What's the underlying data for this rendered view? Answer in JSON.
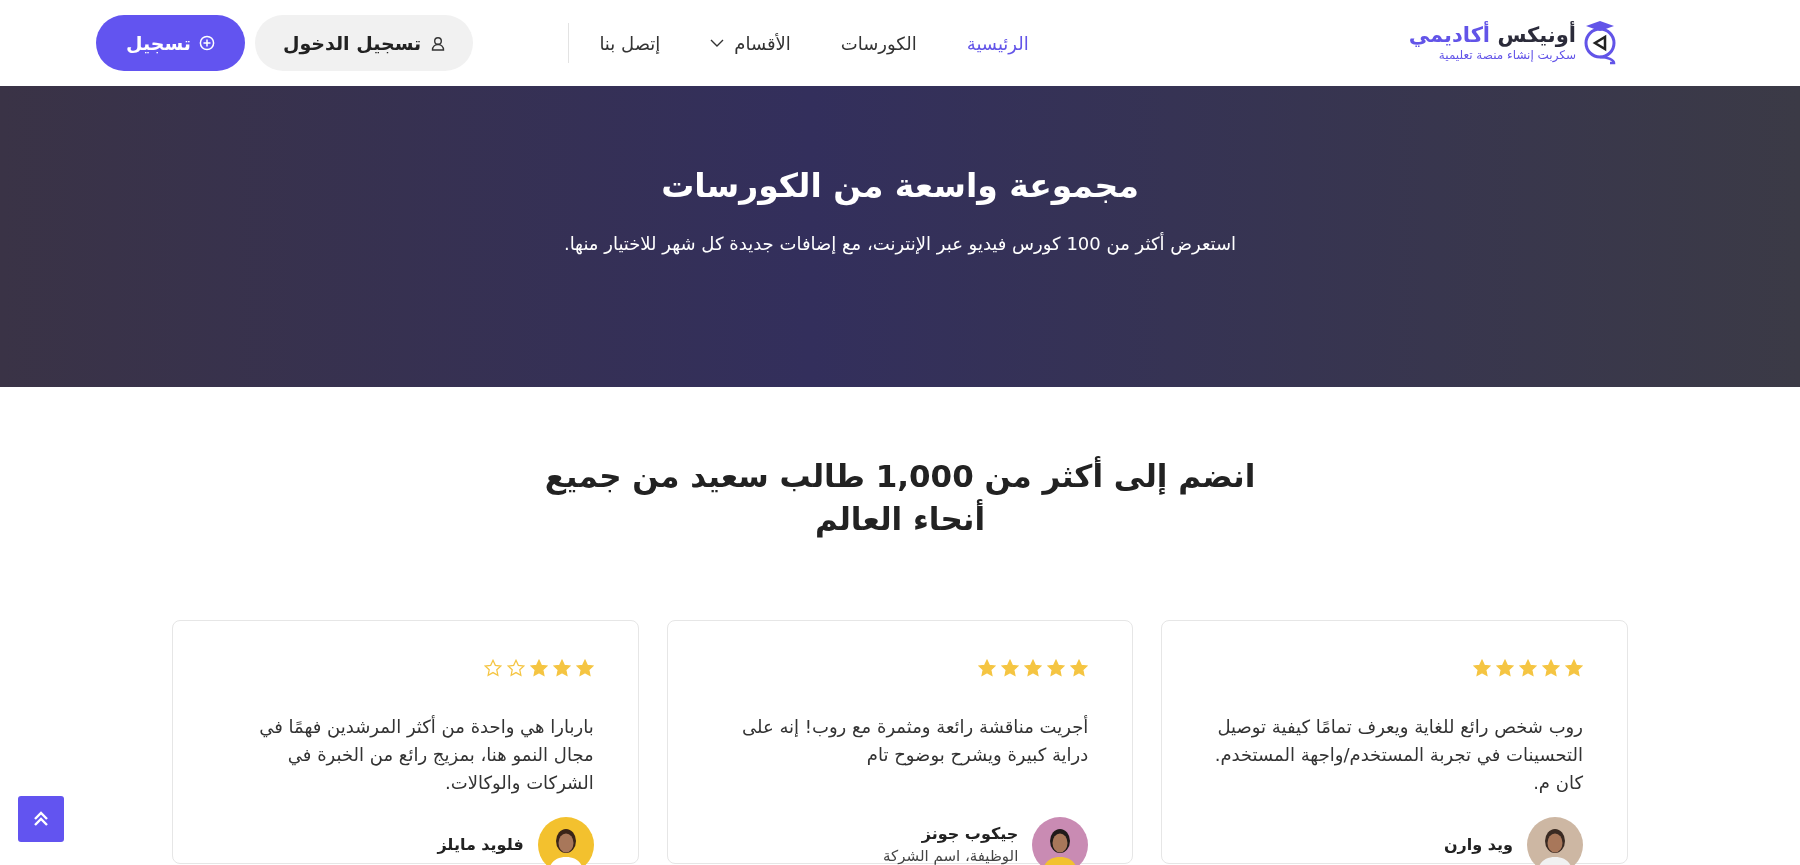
{
  "header": {
    "logo": {
      "name_dark": "أونيكس",
      "name_accent": "أكاديمي",
      "tagline": "سكربت إنشاء منصة تعليمية"
    },
    "nav": [
      {
        "label": "الرئيسية",
        "selected": true,
        "dropdown": false
      },
      {
        "label": "الكورسات",
        "selected": false,
        "dropdown": false
      },
      {
        "label": "الأقسام",
        "selected": false,
        "dropdown": true
      },
      {
        "label": "إتصل بنا",
        "selected": false,
        "dropdown": false
      }
    ],
    "login_button": "تسجيل الدخول",
    "register_button": "تسجيل"
  },
  "hero": {
    "title": "مجموعة واسعة من الكورسات",
    "subtitle": "استعرض أكثر من 100 كورس فيديو عبر الإنترنت، مع إضافات جديدة كل شهر للاختيار منها."
  },
  "testimonials": {
    "heading": "انضم إلى أكثر من 1,000 طالب سعيد من جميع أنحاء العالم",
    "cards": [
      {
        "stars": 5,
        "quote": "روب شخص رائع للغاية ويعرف تمامًا كيفية توصيل التحسينات في تجربة المستخدم/واجهة المستخدم. كان م.",
        "name": "ويد وارن"
      },
      {
        "stars": 5,
        "quote": "أجريت مناقشة رائعة ومثمرة مع روب! إنه على دراية كبيرة ويشرح بوضوح تام",
        "name": "جيكوب جونز",
        "role": "الوظيفة، اسم الشركة"
      },
      {
        "stars": 3,
        "quote": "باربارا هي واحدة من أكثر المرشدين فهمًا في مجال النمو هنا، بمزيج رائع من الخبرة في الشركات والوكالات.",
        "name": "فلويد مايلز"
      }
    ]
  }
}
